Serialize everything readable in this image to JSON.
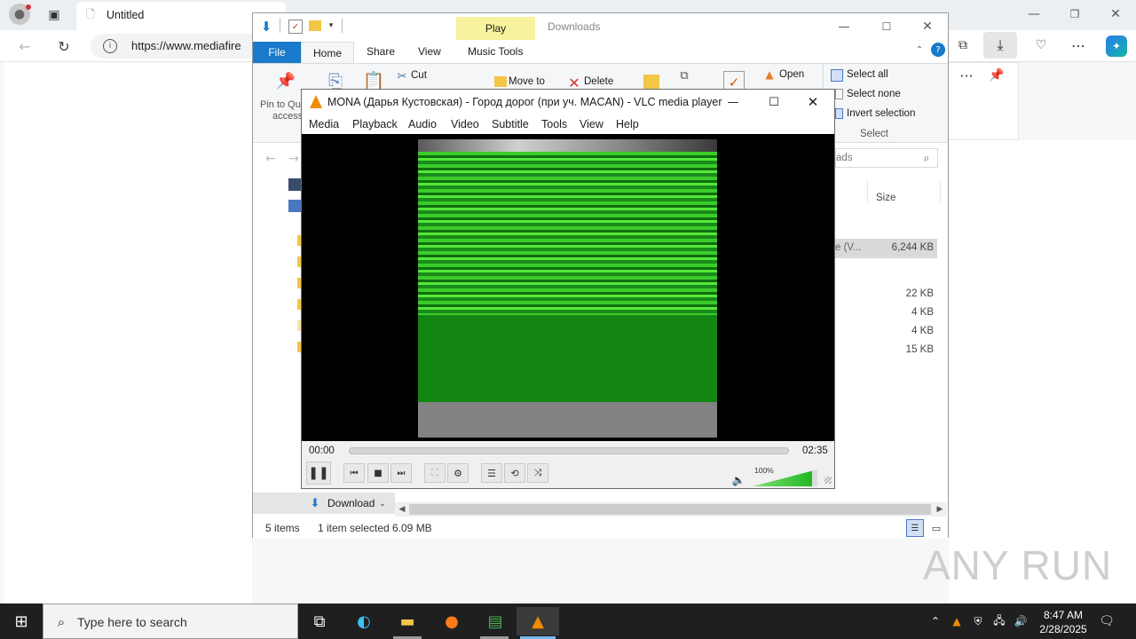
{
  "browser": {
    "tab_title": "Untitled",
    "url": "https://www.mediafire",
    "more_label": "···"
  },
  "explorer": {
    "title": "Downloads",
    "contextual_tab": "Play",
    "tabs": [
      "File",
      "Home",
      "Share",
      "View",
      "Music Tools"
    ],
    "ribbon": {
      "pin_label": "Pin to Qu",
      "pin_label2": "access",
      "cut": "Cut",
      "move_to": "Move to",
      "delete": "Delete",
      "open": "Open",
      "select_all": "Select all",
      "select_none": "Select none",
      "invert_selection": "Invert selection",
      "select_group": "Select"
    },
    "search_placeholder": "ads",
    "column_size": "Size",
    "rows": [
      {
        "type_frag": "e (V...",
        "size": "6,244 KB",
        "selected": true
      },
      {
        "type_frag": "",
        "size": "22 KB",
        "selected": false
      },
      {
        "type_frag": "",
        "size": "4 KB",
        "selected": false
      },
      {
        "type_frag": "",
        "size": "4 KB",
        "selected": false
      },
      {
        "type_frag": "",
        "size": "15 KB",
        "selected": false
      }
    ],
    "nav_download": "Download",
    "status": {
      "items": "5 items",
      "selected": "1 item selected",
      "size": "6.09 MB"
    }
  },
  "vlc": {
    "title": "MONA (Дарья Кустовская) - Город дорог (при уч. MACAN) - VLC media player",
    "menu": [
      "Media",
      "Playback",
      "Audio",
      "Video",
      "Subtitle",
      "Tools",
      "View",
      "Help"
    ],
    "time_elapsed": "00:00",
    "time_total": "02:35",
    "progress": 0.0,
    "volume_label": "100%",
    "volume": 1.0
  },
  "taskbar": {
    "search_placeholder": "Type here to search",
    "time": "8:47 AM",
    "date": "2/28/2025"
  },
  "watermark": "ANY RUN"
}
